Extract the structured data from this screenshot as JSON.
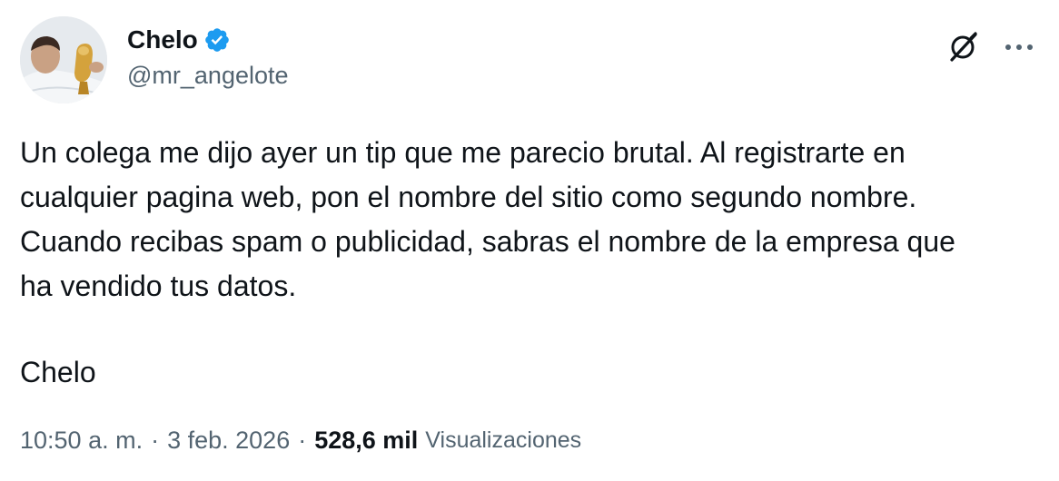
{
  "author": {
    "display_name": "Chelo",
    "handle": "@mr_angelote",
    "verified_badge": "verified-badge-icon",
    "avatar": "avatar-photo"
  },
  "actions": {
    "grok_icon": "grok-icon",
    "more_icon": "more-options-icon"
  },
  "tweet": {
    "text": "Un colega me dijo ayer un tip que me parecio brutal. Al registrarte en\ncualquier pagina web, pon el nombre del sitio como segundo nombre.\nCuando recibas spam o publicidad, sabras el nombre de la empresa que\nha vendido tus datos.",
    "signature": "Chelo"
  },
  "meta": {
    "time": "10:50 a. m.",
    "separator": "·",
    "date": "3 feb. 2026",
    "views_count": "528,6 mil",
    "views_label": "Visualizaciones"
  },
  "colors": {
    "text_primary": "#0f1419",
    "text_secondary": "#536471",
    "verified_blue": "#1d9bf0",
    "background": "#ffffff"
  }
}
